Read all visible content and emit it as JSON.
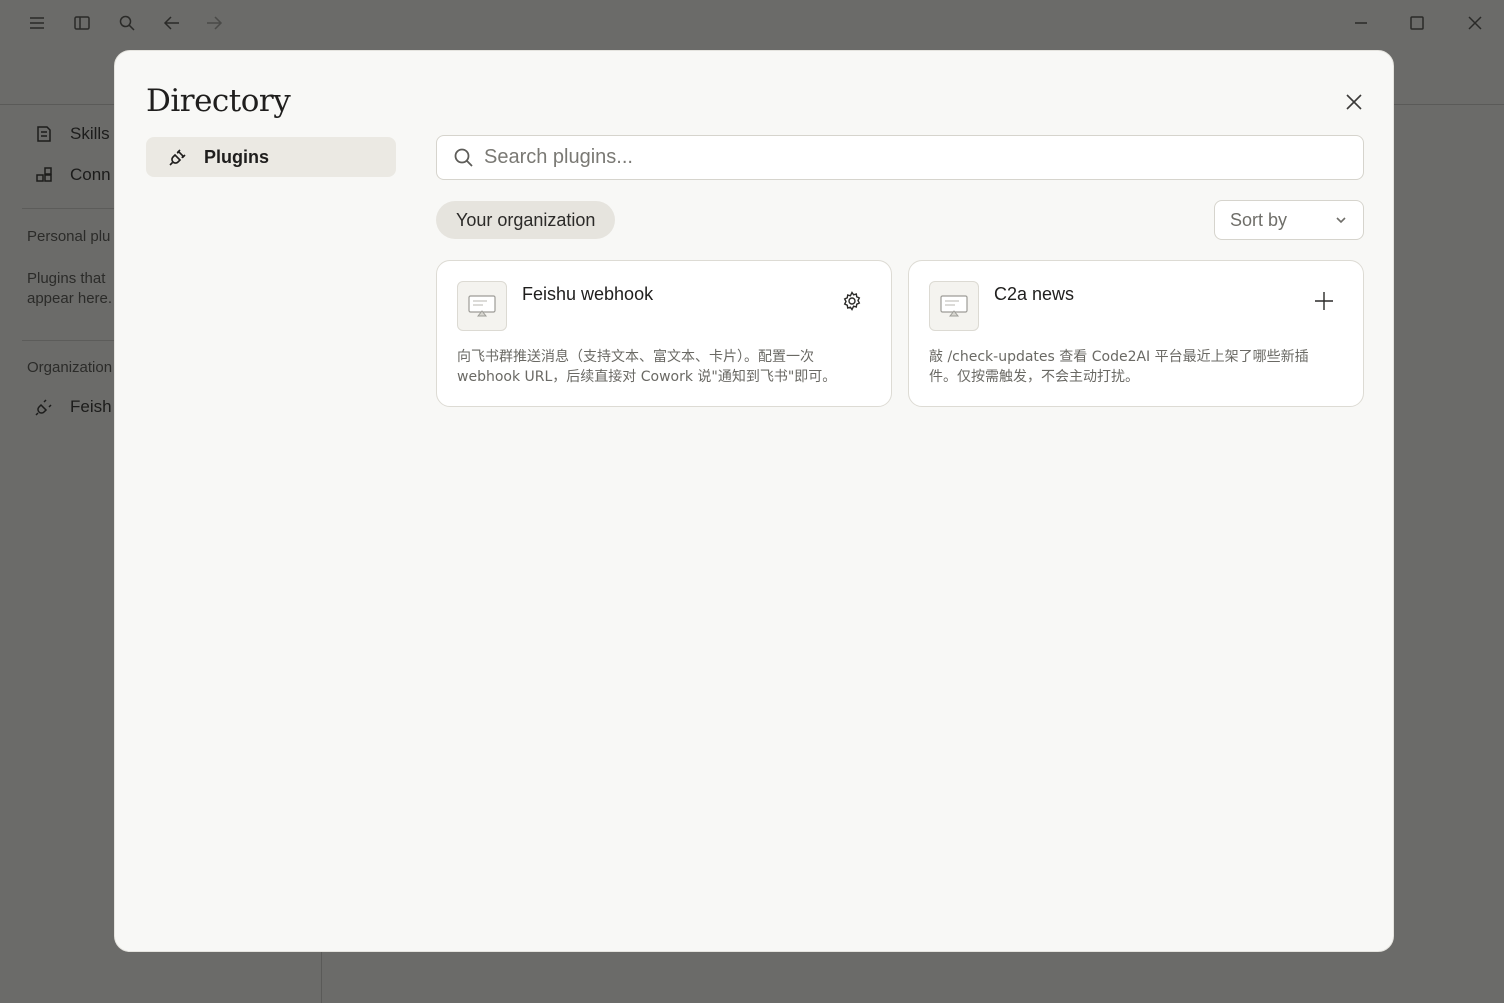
{
  "background_app": {
    "sidebar": {
      "items": [
        {
          "label": "Skills",
          "icon": "skills-icon"
        },
        {
          "label": "Conn",
          "icon": "connectors-icon"
        }
      ],
      "personal_heading": "Personal plu",
      "personal_empty_line1": "Plugins that",
      "personal_empty_line2": "appear here.",
      "org_heading": "Organization",
      "org_items": [
        {
          "label": "Feish",
          "icon": "plug-icon"
        }
      ]
    }
  },
  "modal": {
    "title": "Directory",
    "nav": {
      "plugins_label": "Plugins"
    },
    "search": {
      "placeholder": "Search plugins..."
    },
    "filter_chip": "Your organization",
    "sort": {
      "label": "Sort by"
    },
    "plugins": [
      {
        "name": "Feishu webhook",
        "action_icon": "gear-icon",
        "description_line1": "向飞书群推送消息（支持文本、富文本、卡片）。配置一次",
        "description_line2": "webhook URL，后续直接对 Cowork 说\"通知到飞书\"即可。"
      },
      {
        "name": "C2a news",
        "action_icon": "plus-icon",
        "description_line1": "敲 /check-updates 查看 Code2AI 平台最近上架了哪些新插",
        "description_line2": "件。仅按需触发，不会主动打扰。"
      }
    ]
  }
}
